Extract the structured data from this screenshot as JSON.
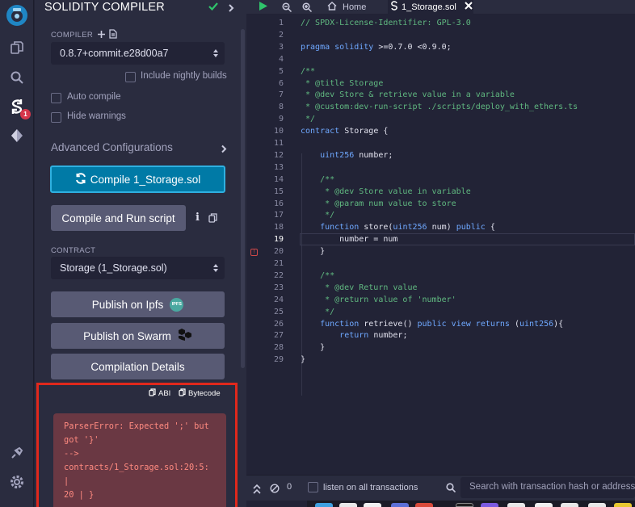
{
  "icon_rail": {
    "items": [
      {
        "name": "remix-logo-icon"
      },
      {
        "name": "file-explorer-icon"
      },
      {
        "name": "search-icon"
      },
      {
        "name": "solidity-compiler-icon"
      },
      {
        "name": "deploy-run-icon"
      },
      {
        "name": "plugin-manager-icon"
      },
      {
        "name": "settings-icon"
      }
    ],
    "compiler_badge": "1"
  },
  "panel": {
    "title": "SOLIDITY COMPILER",
    "compiler_label": "COMPILER",
    "compiler_version": "0.8.7+commit.e28d00a7",
    "include_nightly": "Include nightly builds",
    "auto_compile": "Auto compile",
    "hide_warnings": "Hide warnings",
    "advanced": "Advanced Configurations",
    "compile_button": "Compile 1_Storage.sol",
    "compile_run_button": "Compile and Run script",
    "contract_label": "CONTRACT",
    "contract_value": "Storage (1_Storage.sol)",
    "publish_ipfs": "Publish on Ipfs",
    "ipfs_badge": "IPFS",
    "publish_swarm": "Publish on Swarm",
    "compilation_details": "Compilation Details",
    "abi": "ABI",
    "bytecode": "Bytecode",
    "error_lines": [
      "ParserError: Expected ';' but",
      "got '}'",
      "-->",
      "contracts/1_Storage.sol:20:5:",
      "|",
      "20 | }"
    ]
  },
  "editor": {
    "tabs": [
      {
        "label": "Home"
      },
      {
        "label": "1_Storage.sol"
      }
    ],
    "lines": [
      "// SPDX-License-Identifier: GPL-3.0",
      "",
      "pragma solidity >=0.7.0 <0.9.0;",
      "",
      "/**",
      " * @title Storage",
      " * @dev Store & retrieve value in a variable",
      " * @custom:dev-run-script ./scripts/deploy_with_ethers.ts",
      " */",
      "contract Storage {",
      "",
      "    uint256 number;",
      "",
      "    /**",
      "     * @dev Store value in variable",
      "     * @param num value to store",
      "     */",
      "    function store(uint256 num) public {",
      "        number = num",
      "    }",
      "",
      "    /**",
      "     * @dev Return value",
      "     * @return value of 'number'",
      "     */",
      "    function retrieve() public view returns (uint256){",
      "        return number;",
      "    }",
      "}"
    ],
    "current_line": 19,
    "error_line": 20
  },
  "footer": {
    "tx_count": "0",
    "listen_label": "listen on all transactions",
    "search_placeholder": "Search with transaction hash or address"
  },
  "colors": {
    "accent": "#007aa6",
    "error_border": "#e0281c",
    "error_text": "#ff8a80",
    "success_check": "#2fc46b"
  }
}
